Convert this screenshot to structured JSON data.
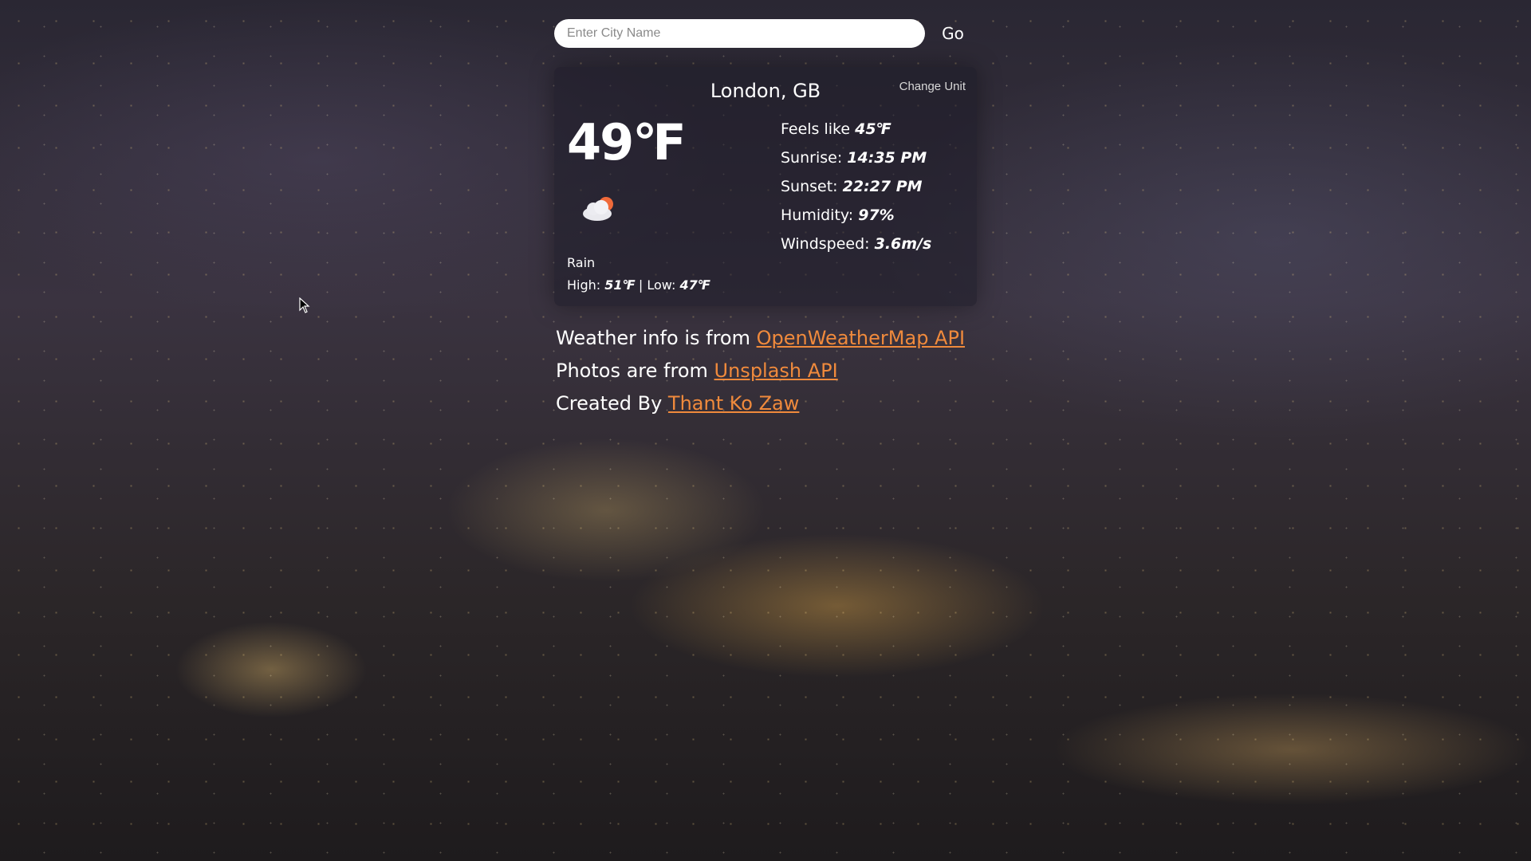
{
  "search": {
    "placeholder": "Enter City Name",
    "value": "",
    "go_label": "Go"
  },
  "weather": {
    "location": "London, GB",
    "change_unit_label": "Change Unit",
    "temperature": "49℉",
    "icon": "cloud-with-sun-icon",
    "condition": "Rain",
    "high_label": "High:",
    "high_value": "51℉",
    "separator": "|",
    "low_label": "Low:",
    "low_value": "47℉",
    "details": [
      {
        "label": "Feels like",
        "value": "45℉"
      },
      {
        "label": "Sunrise:",
        "value": "14:35 PM"
      },
      {
        "label": "Sunset:",
        "value": "22:27 PM"
      },
      {
        "label": "Humidity:",
        "value": "97%"
      },
      {
        "label": "Windspeed:",
        "value": "3.6m/s"
      }
    ]
  },
  "credits": {
    "weather_prefix": "Weather info is from",
    "weather_link": "OpenWeatherMap API",
    "photos_prefix": "Photos are from",
    "photos_link": "Unsplash API",
    "created_prefix": "Created By",
    "created_link": "Thant Ko Zaw"
  },
  "colors": {
    "link": "#f08a3c",
    "card_background": "rgba(30,28,40,0.55)",
    "text": "#ffffff"
  }
}
